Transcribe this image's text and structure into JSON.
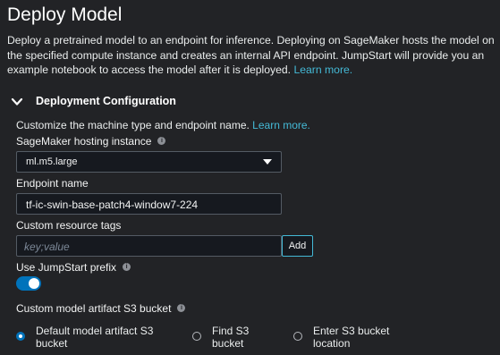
{
  "header": {
    "title": "Deploy Model",
    "description": "Deploy a pretrained model to an endpoint for inference. Deploying on SageMaker hosts the model on the specified compute instance and creates an internal API endpoint. JumpStart will provide you an example notebook to access the model after it is deployed.",
    "learn_more": "Learn more."
  },
  "section": {
    "title": "Deployment Configuration",
    "expanded": true,
    "subtitle": "Customize the machine type and endpoint name.",
    "learn_more": "Learn more."
  },
  "fields": {
    "hosting_instance": {
      "label": "SageMaker hosting instance",
      "value": "ml.m5.large"
    },
    "endpoint_name": {
      "label": "Endpoint name",
      "value": "tf-ic-swin-base-patch4-window7-224"
    },
    "resource_tags": {
      "label": "Custom resource tags",
      "placeholder": "key;value",
      "add_label": "Add"
    },
    "jumpstart_prefix": {
      "label": "Use JumpStart prefix",
      "enabled": true
    },
    "s3_bucket": {
      "label": "Custom model artifact S3 bucket",
      "options": [
        {
          "line1": "Default model artifact S3",
          "line2": "bucket",
          "selected": true
        },
        {
          "line1": "Find S3",
          "line2": "bucket",
          "selected": false
        },
        {
          "line1": "Enter S3 bucket",
          "line2": "location",
          "selected": false
        }
      ]
    }
  },
  "icons": {
    "info": "i",
    "chevron": "chevron-down-icon"
  },
  "colors": {
    "background": "#222326",
    "link": "#44b9d6",
    "accent": "#0073bb"
  }
}
